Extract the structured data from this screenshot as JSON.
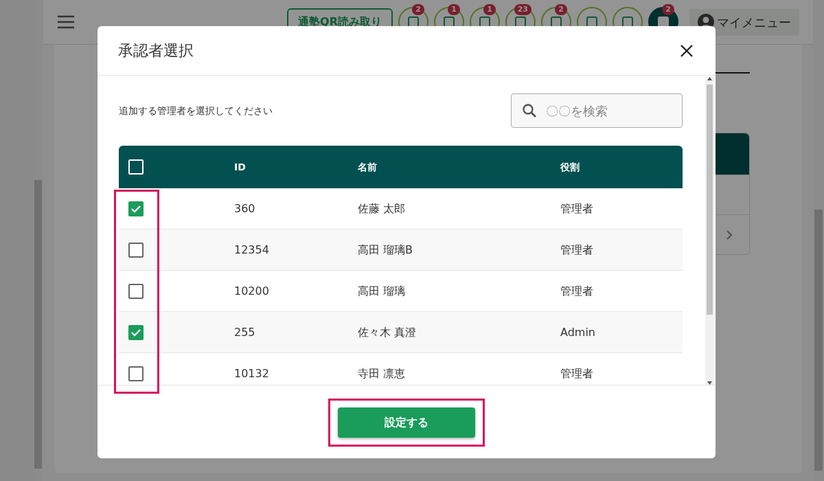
{
  "app_bar": {
    "qr_button": "通塾QR読み取り",
    "icons": [
      {
        "kind": "outline",
        "badge": "2"
      },
      {
        "kind": "outline",
        "badge": "1"
      },
      {
        "kind": "outline",
        "badge": "1"
      },
      {
        "kind": "outline",
        "badge": "23"
      },
      {
        "kind": "outline",
        "badge": "2"
      },
      {
        "kind": "outline"
      },
      {
        "kind": "outline"
      },
      {
        "kind": "filled",
        "badge": "2"
      }
    ],
    "menu_label": "マイメニュー"
  },
  "modal": {
    "title": "承認者選択",
    "instruction": "追加する管理者を選択してください",
    "search": {
      "placeholder": "〇〇を検索"
    },
    "table": {
      "select_all_checked": false,
      "columns": [
        "ID",
        "名前",
        "役割"
      ],
      "checkbox_column_highlighted": true,
      "rows": [
        {
          "checked": true,
          "id": "360",
          "name": "佐藤 太郎",
          "role": "管理者"
        },
        {
          "checked": false,
          "id": "12354",
          "name": "高田 瑠璃B",
          "role": "管理者"
        },
        {
          "checked": false,
          "id": "10200",
          "name": "高田 瑠璃",
          "role": "管理者"
        },
        {
          "checked": true,
          "id": "255",
          "name": "佐々木 真澄",
          "role": "Admin"
        },
        {
          "checked": false,
          "id": "10132",
          "name": "寺田 凛恵",
          "role": "管理者"
        }
      ]
    },
    "submit": {
      "label": "設定する",
      "highlighted": true
    }
  }
}
